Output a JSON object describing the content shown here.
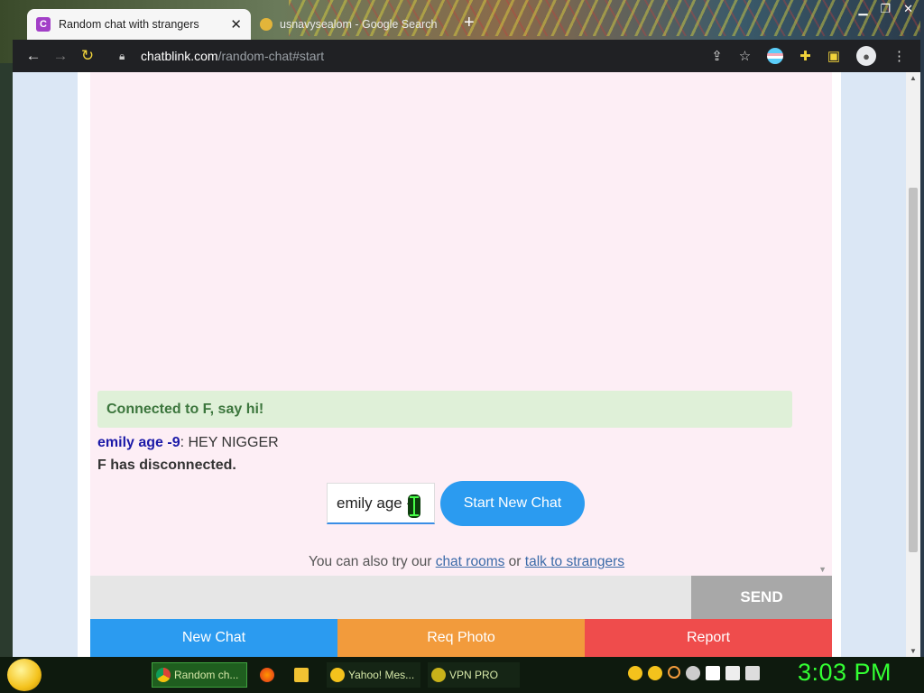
{
  "browser": {
    "tabs": [
      {
        "title": "Random chat with strangers",
        "active": true,
        "favicon": "chatblink-c-icon"
      },
      {
        "title": "usnavyseal",
        "active": false,
        "favicon": "google-icon",
        "title_rest": "om - Google Search"
      }
    ],
    "url_host": "chatblink.com",
    "url_path": "/random-chat#start"
  },
  "chat": {
    "status": "Connected to F, say hi!",
    "messages": [
      {
        "sender": "emily age -9",
        "text": ": HEY NIGGER"
      }
    ],
    "disconnect_notice": "F has disconnected.",
    "name_input_value": "emily age -9",
    "start_new_chat": "Start New Chat",
    "alt_prefix": "You can also try our",
    "alt_link1": "chat rooms",
    "alt_mid": "or",
    "alt_link2": "talk to strangers",
    "send_label": "SEND",
    "send_placeholder": ""
  },
  "actions": {
    "new_chat": "New Chat",
    "req_photo": "Req Photo",
    "report": "Report"
  },
  "taskbar": {
    "items": [
      {
        "label": "Random ch...",
        "icon": "chrome-icon"
      },
      {
        "label": "",
        "icon": "firefox-icon"
      },
      {
        "label": "",
        "icon": "folder-icon"
      },
      {
        "label": "Yahoo! Mes...",
        "icon": "yahoo-messenger-icon"
      },
      {
        "label": "VPN PRO",
        "icon": "vpn-icon"
      }
    ],
    "clock": "3:03 PM"
  },
  "colors": {
    "accent_blue": "#2b9bf0",
    "photo_orange": "#f29b3c",
    "report_red": "#ef4c4c",
    "status_green_bg": "#dff0d8",
    "chat_bg": "#fdeef5",
    "clock_green": "#33ff33"
  }
}
